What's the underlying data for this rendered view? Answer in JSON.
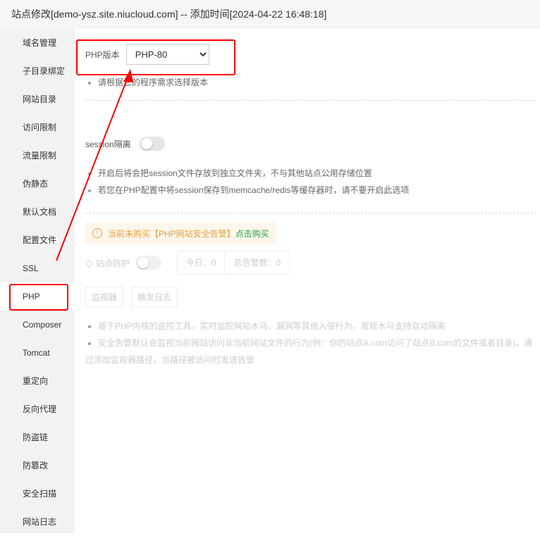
{
  "title": "站点修改[demo-ysz.site.niucloud.com] -- 添加时间[2024-04-22 16:48:18]",
  "sidebar": {
    "items": [
      "域名管理",
      "子目录绑定",
      "网站目录",
      "访问限制",
      "流量限制",
      "伪静态",
      "默认文档",
      "配置文件",
      "SSL",
      "PHP",
      "Composer",
      "Tomcat",
      "重定向",
      "反向代理",
      "防盗链",
      "防篡改",
      "安全扫描",
      "网站日志"
    ],
    "active": "PHP"
  },
  "php": {
    "label": "PHP版本",
    "selected": "PHP-80",
    "tip": "请根据您的程序需求选择版本"
  },
  "session": {
    "label": "session隔离",
    "enabled": false,
    "tips": [
      "开启后将会把session文件存放到独立文件夹，不与其他站点公用存储位置",
      "若您在PHP配置中将session保存到memcache/redis等缓存器时，请不要开启此选项"
    ]
  },
  "security": {
    "warning": "当前未购买【PHP网站安全告警】",
    "buy_link": "点击购买",
    "protect_label": "站点防护",
    "protect_enabled": false,
    "today": "今日：0",
    "total": "总告警数：0",
    "monitor_btn": "监视器",
    "log_btn": "触发日志",
    "tips": [
      "基于PHP内核的监控工具，实时监控网站木马、漏洞等其他入侵行为，发现木马支持自动隔离",
      "安全告警默认会监视当前网站访问非当前网站文件的行为(例：你的站点A.com访问了站点B.com的文件或者目录)，通过添加监视器路径，当路径被访问时发送告警"
    ]
  },
  "colors": {
    "annotation": "#ff0000",
    "warning": "#e6a23c",
    "link": "#20a53a"
  }
}
